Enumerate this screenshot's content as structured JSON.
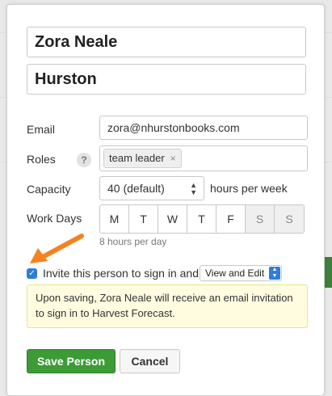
{
  "form": {
    "first_name": "Zora Neale",
    "last_name": "Hurston",
    "email_label": "Email",
    "email_value": "zora@nhurstonbooks.com",
    "roles_label": "Roles",
    "roles_help": "?",
    "role_tag": "team leader",
    "role_remove": "×",
    "capacity_label": "Capacity",
    "capacity_value": "40 (default)",
    "capacity_suffix": "hours per week",
    "workdays_label": "Work Days",
    "days": [
      "M",
      "T",
      "W",
      "T",
      "F",
      "S",
      "S"
    ],
    "workdays_hint": "8 hours per day",
    "invite_label": "Invite this person to sign in and",
    "permission_value": "View and Edit",
    "notice": "Upon saving, Zora Neale will receive an email invitation to sign in to Harvest Forecast."
  },
  "buttons": {
    "save": "Save Person",
    "cancel": "Cancel"
  },
  "colors": {
    "primary_green": "#3d9b37",
    "accent_blue": "#2f7ed8",
    "arrow_orange": "#f5821f",
    "notice_bg": "#fffce0"
  }
}
